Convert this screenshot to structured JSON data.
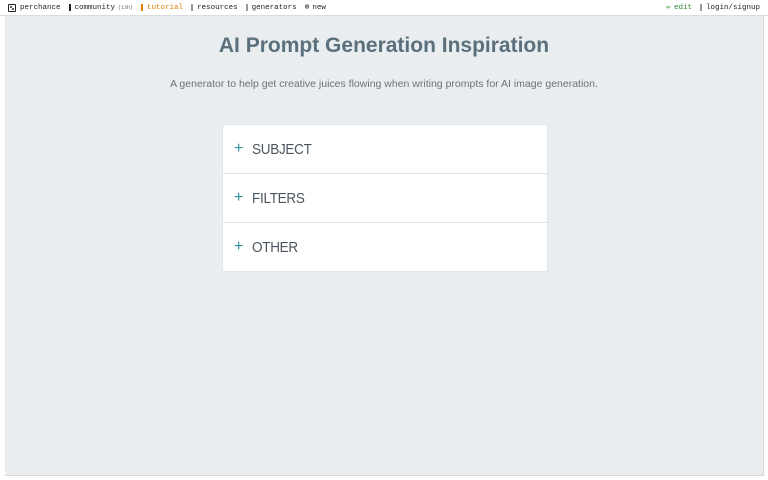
{
  "topbar": {
    "brand": "perchance",
    "community": "community",
    "community_count": "(13h)",
    "tutorial": "tutorial",
    "resources": "resources",
    "generators": "generators",
    "new": "new",
    "edit": "edit",
    "login": "login/signup"
  },
  "header": {
    "title": "AI Prompt Generation Inspiration",
    "subtitle": "A generator to help get creative juices flowing when writing prompts for AI image generation."
  },
  "sections": [
    {
      "label": "SUBJECT",
      "icon": "+"
    },
    {
      "label": "FILTERS",
      "icon": "+"
    },
    {
      "label": "OTHER",
      "icon": "+"
    }
  ],
  "colors": {
    "accent": "#2f8f9d",
    "title": "#5b6f7c",
    "background": "#e9edf0",
    "tutorial": "#e07a00",
    "edit": "#2e8b2e"
  }
}
